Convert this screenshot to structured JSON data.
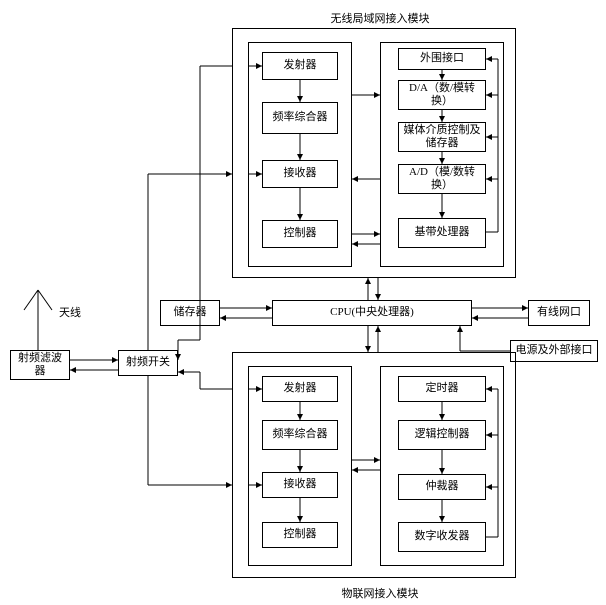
{
  "titles": {
    "wlan_module": "无线局域网接入模块",
    "iot_module": "物联网接入模块"
  },
  "wlan": {
    "transmitter": "发射器",
    "synthesizer": "频率综合器",
    "receiver": "接收器",
    "controller": "控制器",
    "periph_iface": "外围接口",
    "da": "D/A（数/模转换）",
    "mac": "媒体介质控制及储存器",
    "ad": "A/D（模/数转换）",
    "baseband": "基带处理器"
  },
  "center": {
    "memory": "储存器",
    "cpu": "CPU(中央处理器)",
    "wired_port": "有线网口",
    "power_iface": "电源及外部接口"
  },
  "left": {
    "antenna": "天线",
    "rf_filter": "射频滤波器",
    "rf_switch": "射频开关"
  },
  "iot": {
    "transmitter": "发射器",
    "synthesizer": "频率综合器",
    "receiver": "接收器",
    "controller": "控制器",
    "timer": "定时器",
    "logic_ctrl": "逻辑控制器",
    "arbiter": "仲裁器",
    "transceiver": "数字收发器"
  }
}
